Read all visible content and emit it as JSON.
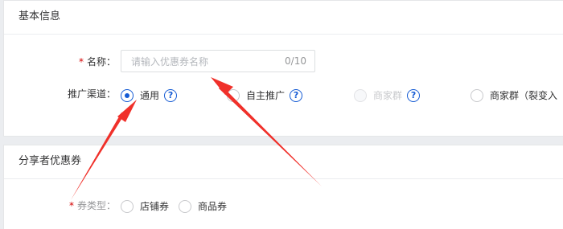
{
  "basic_section": {
    "title": "基本信息",
    "name_field": {
      "required_mark": "*",
      "label": "名称：",
      "placeholder": "请输入优惠券名称",
      "counter": "0/10"
    },
    "channel": {
      "label": "推广渠道：",
      "options": [
        {
          "label": "通用",
          "checked": true,
          "disabled": false,
          "has_help": true
        },
        {
          "label": "自主推广",
          "checked": false,
          "disabled": false,
          "has_help": true
        },
        {
          "label": "商家群",
          "checked": false,
          "disabled": true,
          "has_help": true
        },
        {
          "label": "商家群（裂变入",
          "checked": false,
          "disabled": false,
          "has_help": false
        }
      ],
      "help_glyph": "?"
    }
  },
  "share_section": {
    "title": "分享者优惠券",
    "coupon_type": {
      "required_mark": "*",
      "label": "券类型：",
      "options": [
        {
          "label": "店铺券",
          "checked": false
        },
        {
          "label": "商品券",
          "checked": false
        }
      ]
    }
  },
  "colors": {
    "accent": "#155bd4",
    "arrow": "#f0302a",
    "required": "#d40000"
  }
}
